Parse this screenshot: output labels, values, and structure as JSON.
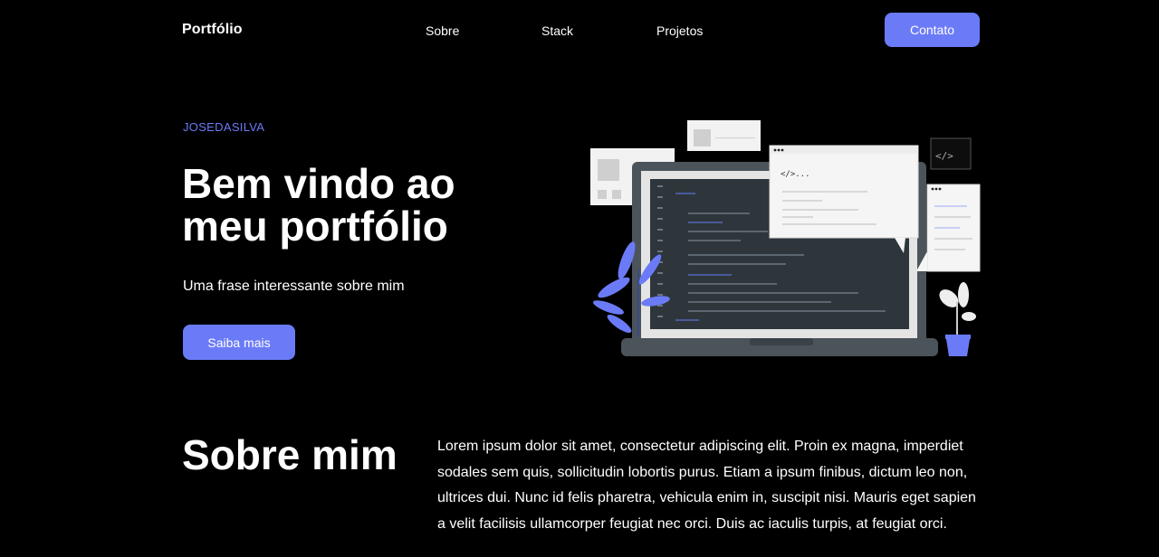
{
  "nav": {
    "brand": "Portfólio",
    "links": [
      "Sobre",
      "Stack",
      "Projetos"
    ],
    "contact_label": "Contato"
  },
  "hero": {
    "eyebrow": "JOSEDASILVA",
    "title": "Bem vindo ao meu portfólio",
    "subtitle": "Uma frase interessante sobre mim",
    "cta_label": "Saiba mais",
    "illustration": {
      "code_snippet": "</>...",
      "code_icon_text": "</>"
    }
  },
  "about": {
    "title": "Sobre mim",
    "text": "Lorem ipsum dolor sit amet, consectetur adipiscing elit. Proin ex magna, imperdiet sodales sem quis, sollicitudin lobortis purus. Etiam a ipsum finibus, dictum leo non, ultrices dui. Nunc id felis pharetra, vehicula enim in, suscipit nisi. Mauris eget sapien a velit facilisis ullamcorper feugiat nec orci. Duis ac iaculis turpis, at feugiat orci."
  },
  "colors": {
    "background": "#000000",
    "accent": "#6b7bf7",
    "text": "#ffffff"
  }
}
